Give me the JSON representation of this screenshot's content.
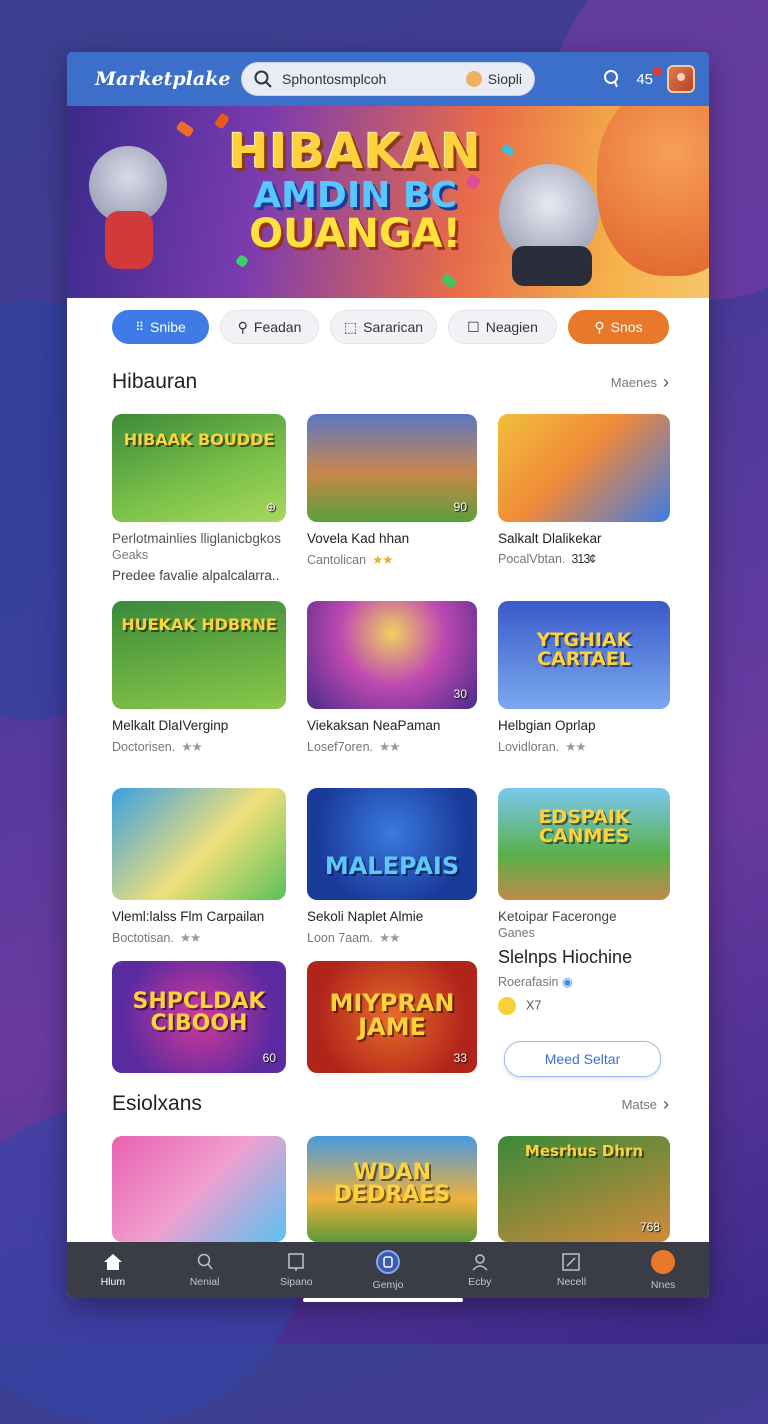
{
  "app": {
    "name": "Marketplake"
  },
  "search": {
    "value": "Sphontosmplcoh",
    "chip_label": "Siopli"
  },
  "header": {
    "notifications_count": "45"
  },
  "hero": {
    "line1": "HIBAKAN",
    "line2": "AMDIN BC",
    "line3": "OUANGA!"
  },
  "filters": [
    {
      "label": "Snibe",
      "icon": "grid-icon",
      "active": true
    },
    {
      "label": "Feadan",
      "icon": "key-icon"
    },
    {
      "label": "Sararican",
      "icon": "cube-icon"
    },
    {
      "label": "Neagien",
      "icon": "square-icon"
    },
    {
      "label": "Snos",
      "icon": "key-icon",
      "highlight": "#e8782a"
    }
  ],
  "section1": {
    "title": "Hibauran",
    "more": "Maenes",
    "games": [
      {
        "thumb_title": "HIBAAK BOUDDE",
        "name": "Perlotmainlies lliglanicbgkos",
        "sub": "Geaks",
        "extra": "Predee favalie alpalcalarra..",
        "badge": "",
        "colors": [
          "#3d8a3a",
          "#7cc24a"
        ]
      },
      {
        "thumb_title": "",
        "name": "Vovela Kad hhan",
        "sub": "Cantolican",
        "stars": "★★",
        "badge": "90",
        "colors": [
          "#3a5aa0",
          "#c9864a"
        ]
      },
      {
        "thumb_title": "",
        "name": "Salkalt Dlalikekar",
        "sub": "PocalVbtan.",
        "stars": "313¢",
        "badge": "",
        "colors": [
          "#f0c03a",
          "#3e7be6"
        ]
      },
      {
        "thumb_title": "HUEKAK HDBRNE",
        "name": "Melkalt DlaIVerginp",
        "sub": "Doctorisen.",
        "stars": "★★",
        "badge": "",
        "colors": [
          "#3a8a3a",
          "#8ac84a"
        ]
      },
      {
        "thumb_title": "",
        "name": "Viekaksan NeaPaman",
        "sub": "Losef7oren.",
        "stars": "★★",
        "badge": "30",
        "colors": [
          "#4a2a8a",
          "#e0a03a"
        ]
      },
      {
        "thumb_title": "YTGHIAK CARTAEL",
        "name": "Helbgian Oprlap",
        "sub": "Lovidloran.",
        "stars": "★★",
        "badge": "",
        "colors": [
          "#3a5ac8",
          "#7aa8f0"
        ]
      },
      {
        "thumb_title": "",
        "name": "Vleml:lalss Flm Carpailan",
        "sub": "Boctotisan.",
        "stars": "★★",
        "badge": "",
        "colors": [
          "#3aa0e0",
          "#e8d24a"
        ]
      },
      {
        "thumb_title": "MALEPAIS",
        "name": "Sekoli Naplet Almie",
        "sub": "Loon 7aam.",
        "stars": "★★",
        "badge": "",
        "colors": [
          "#1a3a9a",
          "#3a7ae0"
        ]
      },
      {
        "thumb_title": "EDSPAIK CANMES",
        "name": "Ketoipar Faceronge",
        "sub": "Ganes",
        "badge": "",
        "colors": [
          "#5ab04a",
          "#f0c04a"
        ]
      },
      {
        "thumb_title": "SHPCLDAK CIBOOH",
        "name": "",
        "sub": "",
        "badge": "60",
        "colors": [
          "#5a2aa0",
          "#d03a9a"
        ]
      },
      {
        "thumb_title": "MIYPRAN JAME",
        "name": "",
        "sub": "",
        "badge": "33",
        "colors": [
          "#b0241a",
          "#e86a2a"
        ]
      }
    ],
    "featured": {
      "name": "Slelnps Hiochine",
      "sub": "Roerafasin",
      "rating": "X7",
      "button": "Meed Seltar"
    }
  },
  "section2": {
    "title": "Esiolxans",
    "more": "Matse",
    "games": [
      {
        "thumb_title": "",
        "badge": "",
        "colors": [
          "#e860b0",
          "#5ac0f0"
        ]
      },
      {
        "thumb_title": "WDAN DEDRAES",
        "badge": "",
        "colors": [
          "#4a9ae0",
          "#f0b03a"
        ]
      },
      {
        "thumb_title": "Mesrhus Dhrn",
        "badge": "768",
        "colors": [
          "#3a8a3a",
          "#d08a3a"
        ]
      }
    ]
  },
  "bottom_nav": [
    {
      "label": "Hlum",
      "icon": "home-icon",
      "active": true
    },
    {
      "label": "Nenial",
      "icon": "search-icon"
    },
    {
      "label": "Sipano",
      "icon": "bookmark-icon"
    },
    {
      "label": "Gemjo",
      "icon": "game-icon",
      "highlight": true
    },
    {
      "label": "Ecby",
      "icon": "user-icon"
    },
    {
      "label": "Necell",
      "icon": "edit-icon"
    },
    {
      "label": "Nnes",
      "icon": "bag-icon"
    }
  ]
}
